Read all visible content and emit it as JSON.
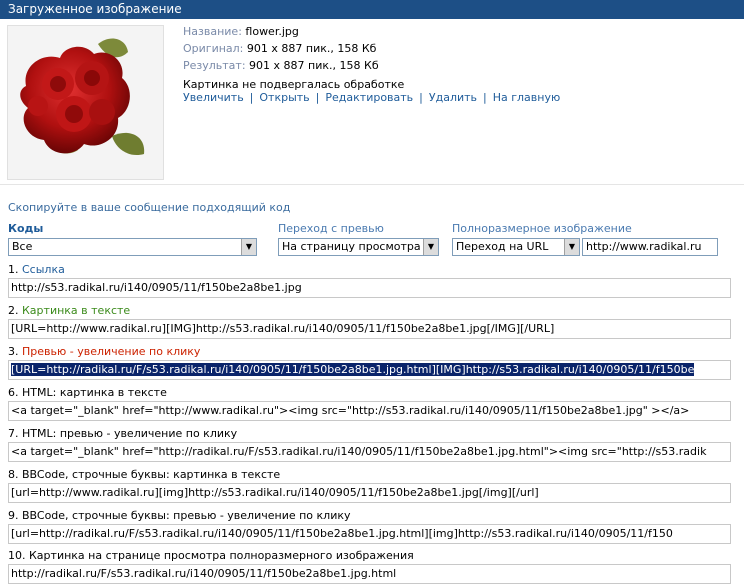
{
  "header": {
    "title": "Загруженное изображение"
  },
  "file": {
    "name_label": "Название:",
    "name_value": "flower.jpg",
    "original_label": "Оригинал:",
    "original_value": "901 x 887 пик., 158 Кб",
    "result_label": "Результат:",
    "result_value": "901 x 887 пик., 158 Кб",
    "status": "Картинка не подвергалась обработке"
  },
  "actions": {
    "items": [
      "Увеличить",
      "Открыть",
      "Редактировать",
      "Удалить",
      "На главную"
    ],
    "separator": "|"
  },
  "copy_hint": "Скопируйте в ваше сообщение подходящий код",
  "filters": {
    "codes_label": "Коды",
    "codes_value": "Все",
    "preview_label": "Переход с превью",
    "preview_value": "На страницу просмотра",
    "full_label": "Полноразмерное изображение",
    "full_value": "Переход на URL",
    "url_value": "http://www.radikal.ru"
  },
  "codes": [
    {
      "num": "1.",
      "label": "Ссылка",
      "value": "http://s53.radikal.ru/i140/0905/11/f150be2a8be1.jpg"
    },
    {
      "num": "2.",
      "label": "Картинка в тексте",
      "value": "[URL=http://www.radikal.ru][IMG]http://s53.radikal.ru/i140/0905/11/f150be2a8be1.jpg[/IMG][/URL]"
    },
    {
      "num": "3.",
      "label": "Превью - увеличение по клику",
      "value": "[URL=http://radikal.ru/F/s53.radikal.ru/i140/0905/11/f150be2a8be1.jpg.html][IMG]http://s53.radikal.ru/i140/0905/11/f150be"
    },
    {
      "num": "6.",
      "label": "HTML: картинка в тексте",
      "value": "<a target=\"_blank\" href=\"http://www.radikal.ru\"><img src=\"http://s53.radikal.ru/i140/0905/11/f150be2a8be1.jpg\" ></a>"
    },
    {
      "num": "7.",
      "label": "HTML: превью - увеличение по клику",
      "value": "<a target=\"_blank\" href=\"http://radikal.ru/F/s53.radikal.ru/i140/0905/11/f150be2a8be1.jpg.html\"><img src=\"http://s53.radik"
    },
    {
      "num": "8.",
      "label": "BBCode, строчные буквы: картинка в тексте",
      "value": "[url=http://www.radikal.ru][img]http://s53.radikal.ru/i140/0905/11/f150be2a8be1.jpg[/img][/url]"
    },
    {
      "num": "9.",
      "label": "BBCode, строчные буквы: превью - увеличение по клику",
      "value": "[url=http://radikal.ru/F/s53.radikal.ru/i140/0905/11/f150be2a8be1.jpg.html][img]http://s53.radikal.ru/i140/0905/11/f150"
    },
    {
      "num": "10.",
      "label": "Картинка на странице просмотра полноразмерного изображения",
      "value": "http://radikal.ru/F/s53.radikal.ru/i140/0905/11/f150be2a8be1.jpg.html"
    }
  ]
}
